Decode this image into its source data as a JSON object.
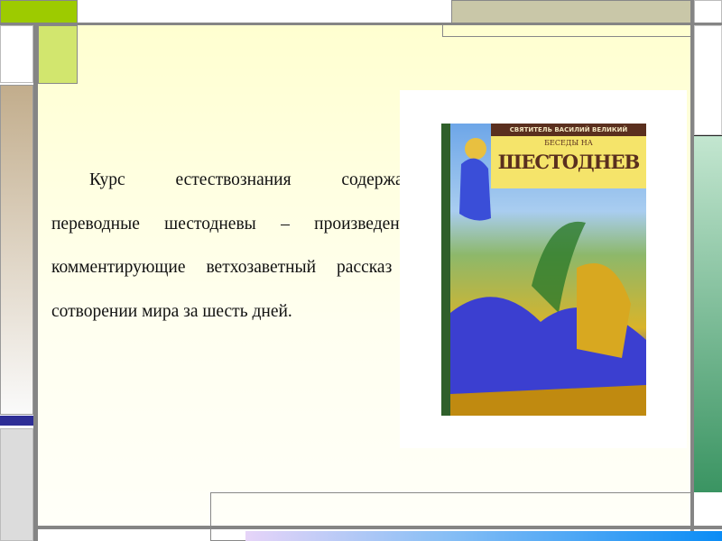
{
  "slide": {
    "paragraph": "Курс естествознания содержали переводные шестодневы – произведения, комментирующие ветхозаветный рассказ о сотворении мира за шесть дней."
  },
  "book_cover": {
    "author": "СВЯТИТЕЛЬ ВАСИЛИЙ ВЕЛИКИЙ",
    "subtitle": "БЕСЕДЫ НА",
    "title": "ШЕСТОДНЕВ"
  },
  "colors": {
    "green_block": "#9dcb00",
    "light_green_block": "#d2e66e",
    "tan_block": "#c9c7a8",
    "tan_gradient": "#c2ad8c",
    "blue_band": "#2e2e96",
    "right_green": "#3a9462",
    "bottom_bar": "#0a8cf5",
    "divider": "#858585"
  }
}
